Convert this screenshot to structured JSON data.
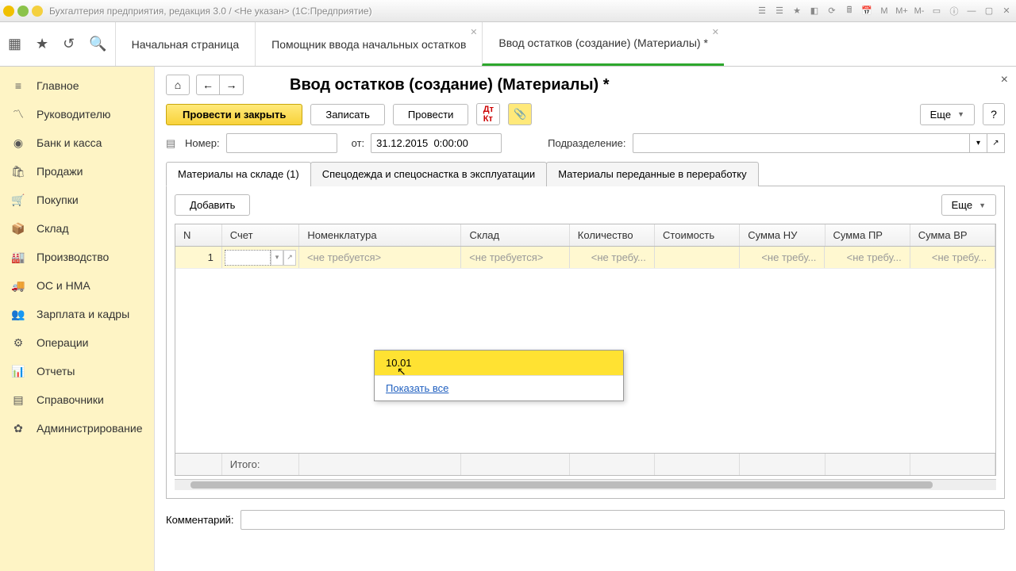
{
  "titlebar": {
    "title": "Бухгалтерия предприятия, редакция 3.0 / <Не указан> (1С:Предприятие)"
  },
  "toptabs": {
    "items": [
      {
        "label": "Начальная страница",
        "closable": false
      },
      {
        "label": "Помощник ввода начальных остатков",
        "closable": true
      },
      {
        "label": "Ввод остатков (создание) (Материалы) *",
        "closable": true,
        "active": true
      }
    ]
  },
  "sidebar": {
    "items": [
      {
        "label": "Главное",
        "icon": "≡"
      },
      {
        "label": "Руководителю",
        "icon": "✓"
      },
      {
        "label": "Банк и касса",
        "icon": "●"
      },
      {
        "label": "Продажи",
        "icon": "🛍"
      },
      {
        "label": "Покупки",
        "icon": "🛒"
      },
      {
        "label": "Склад",
        "icon": "📦"
      },
      {
        "label": "Производство",
        "icon": "🏭"
      },
      {
        "label": "ОС и НМА",
        "icon": "🚚"
      },
      {
        "label": "Зарплата и кадры",
        "icon": "👥"
      },
      {
        "label": "Операции",
        "icon": "⚙"
      },
      {
        "label": "Отчеты",
        "icon": "📊"
      },
      {
        "label": "Справочники",
        "icon": "📚"
      },
      {
        "label": "Администрирование",
        "icon": "⚙"
      }
    ]
  },
  "page": {
    "title": "Ввод остатков (создание) (Материалы) *"
  },
  "actions": {
    "post_close": "Провести и закрыть",
    "save": "Записать",
    "post": "Провести",
    "more": "Еще",
    "help": "?"
  },
  "fields": {
    "number_label": "Номер:",
    "number_value": "",
    "date_label": "от:",
    "date_value": "31.12.2015  0:00:00",
    "dept_label": "Подразделение:",
    "dept_value": ""
  },
  "inner_tabs": {
    "items": [
      {
        "label": "Материалы на складе (1)",
        "active": true
      },
      {
        "label": "Спецодежда и спецоснастка в эксплуатации"
      },
      {
        "label": "Материалы переданные в переработку"
      }
    ]
  },
  "grid_actions": {
    "add": "Добавить",
    "more": "Еще"
  },
  "grid": {
    "columns": [
      {
        "key": "n",
        "label": "N"
      },
      {
        "key": "acct",
        "label": "Счет"
      },
      {
        "key": "nom",
        "label": "Номенклатура"
      },
      {
        "key": "skl",
        "label": "Склад"
      },
      {
        "key": "qty",
        "label": "Количество"
      },
      {
        "key": "cost",
        "label": "Стоимость"
      },
      {
        "key": "nu",
        "label": "Сумма НУ"
      },
      {
        "key": "pr",
        "label": "Сумма ПР"
      },
      {
        "key": "vr",
        "label": "Сумма ВР"
      }
    ],
    "rows": [
      {
        "n": "1",
        "acct": "",
        "nom": "<не требуется>",
        "skl": "<не требуется>",
        "qty": "<не требу...",
        "cost": "",
        "nu": "<не требу...",
        "pr": "<не требу...",
        "vr": "<не требу..."
      }
    ],
    "footer_label": "Итого:"
  },
  "dropdown": {
    "option": "10.01",
    "show_all": "Показать все"
  },
  "comment": {
    "label": "Комментарий:",
    "value": ""
  }
}
